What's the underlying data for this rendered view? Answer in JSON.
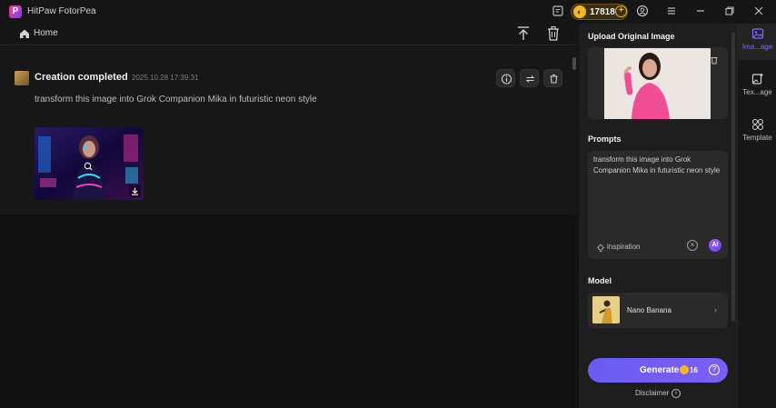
{
  "app": {
    "title": "HitPaw FotorPea",
    "coins": "17818"
  },
  "nav": {
    "home_label": "Home"
  },
  "creation": {
    "title": "Creation completed",
    "timestamp": "2025.10.28  17:39:31",
    "prompt": "transform this image into Grok Companion Mika in futuristic neon style"
  },
  "panel": {
    "upload_title": "Upload Original Image",
    "prompts_title": "Prompts",
    "prompt_text": "transform this image into Grok Companion Mika in futuristic neon style",
    "inspiration_label": "inspiration",
    "ai_label": "AI",
    "model_title": "Model",
    "model_name": "Nano Banana",
    "generate_label": "Generate",
    "generate_cost": "16",
    "disclaimer": "Disclaimer"
  },
  "rail": {
    "items": [
      {
        "label": "Ima...age",
        "icon": "image-icon",
        "active": true
      },
      {
        "label": "Tex...age",
        "icon": "text-image-icon",
        "active": false
      },
      {
        "label": "Template",
        "icon": "template-icon",
        "active": false
      }
    ]
  },
  "colors": {
    "accent": "#7c5ef7",
    "coin": "#f3b821",
    "background": "#121212",
    "panel": "#1e1e1e"
  }
}
